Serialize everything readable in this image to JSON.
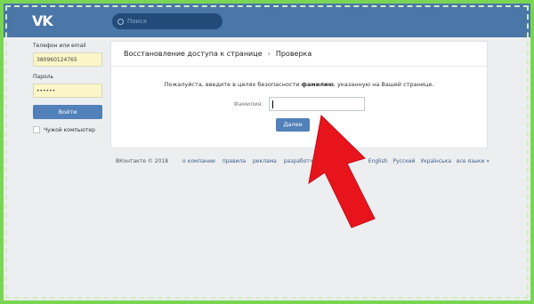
{
  "topbar": {
    "logo": "VK",
    "search_placeholder": "Поиск"
  },
  "login": {
    "phone_label": "Телефон или email",
    "phone_value": "380960124765",
    "password_label": "Пароль",
    "password_value": "••••••",
    "login_button": "Войти",
    "foreign_computer": "Чужой компьютер"
  },
  "panel": {
    "breadcrumb_1": "Восстановление доступа к странице",
    "breadcrumb_2": "Проверка",
    "message_prefix": "Пожалуйста, введите в целях безопасности ",
    "message_bold": "фамилию",
    "message_suffix": ", указанную на Вашей странице.",
    "surname_label": "Фамилия:",
    "next_button": "Далее"
  },
  "footer": {
    "copyright": "ВКонтакте © 2018",
    "links": [
      "о компании",
      "правила",
      "реклама",
      "разработчикам"
    ],
    "langs": [
      "English",
      "Русский",
      "Українська",
      "все языки »"
    ]
  },
  "colors": {
    "accent": "#4a76a8",
    "button": "#5181b8",
    "arrow": "#e8141c",
    "frame": "#79d653"
  }
}
